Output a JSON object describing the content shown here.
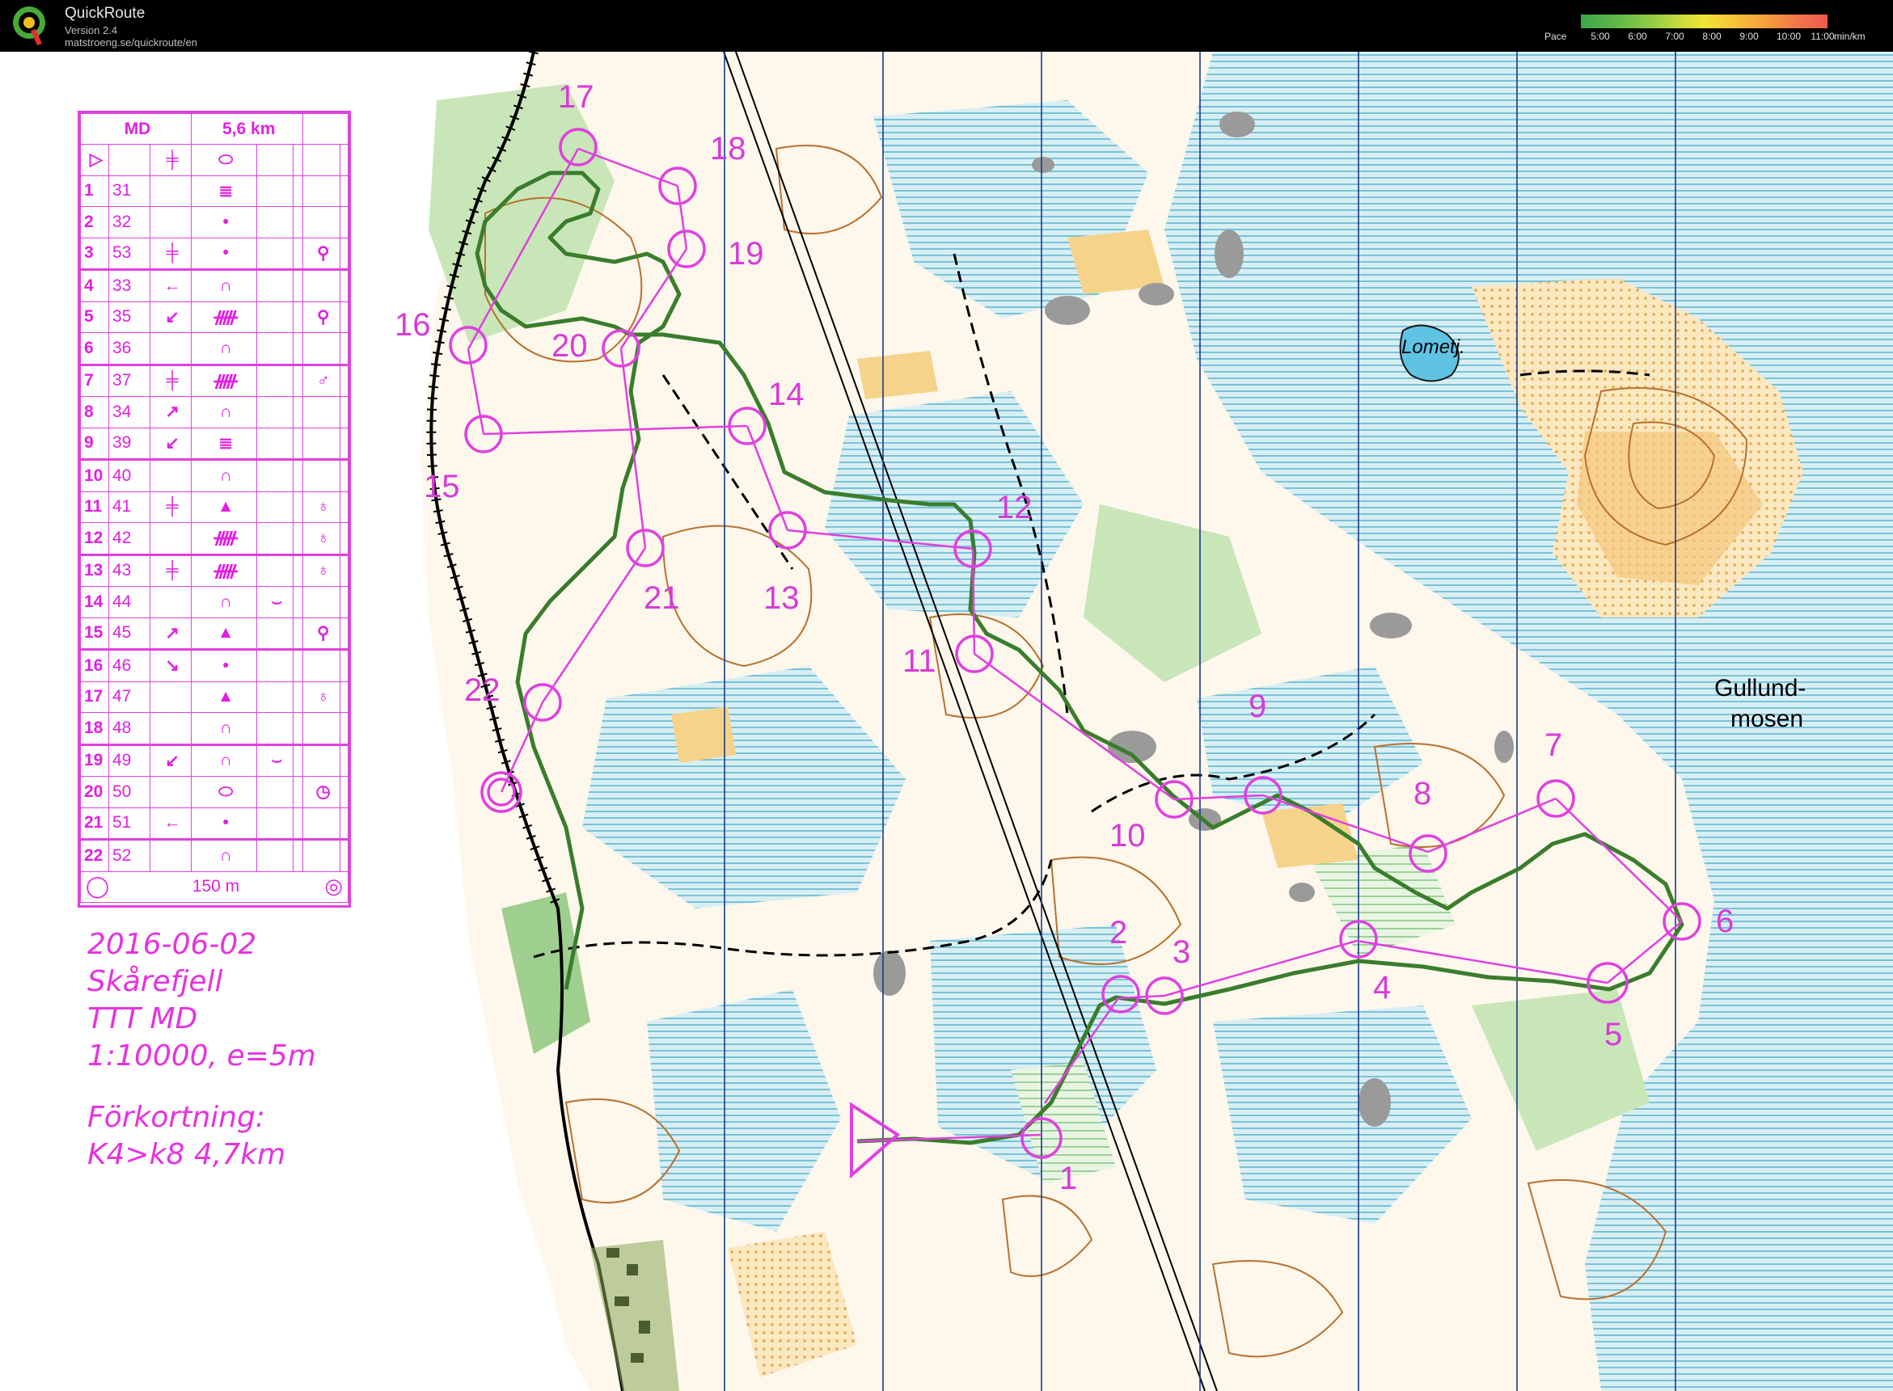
{
  "app": {
    "title": "QuickRoute",
    "version": "Version 2.4",
    "url": "matstroeng.se/quickroute/en",
    "pace_label": "Pace",
    "pace_ticks": [
      "5:00",
      "6:00",
      "7:00",
      "8:00",
      "9:00",
      "10:00",
      "11:00"
    ],
    "pace_unit": "min/km"
  },
  "legend": {
    "event": "MD",
    "length": "5,6 km",
    "rows": [
      {
        "n": "1",
        "code": "31",
        "col3": "",
        "col4": "≣",
        "col5": "",
        "col6": ""
      },
      {
        "n": "2",
        "code": "32",
        "col3": "",
        "col4": "•",
        "col5": "",
        "col6": ""
      },
      {
        "n": "3",
        "code": "53",
        "col3": "╪",
        "col4": "•",
        "col5": "",
        "col6": "⚲"
      },
      {
        "n": "4",
        "code": "33",
        "col3": "←",
        "col4": "∩",
        "col5": "",
        "col6": ""
      },
      {
        "n": "5",
        "code": "35",
        "col3": "↙",
        "col4": "ᚏ",
        "col5": "",
        "col6": "⚲"
      },
      {
        "n": "6",
        "code": "36",
        "col3": "",
        "col4": "∩",
        "col5": "",
        "col6": ""
      },
      {
        "n": "7",
        "code": "37",
        "col3": "╪",
        "col4": "ᚏ",
        "col5": "",
        "col6": "♂"
      },
      {
        "n": "8",
        "code": "34",
        "col3": "↗",
        "col4": "∩",
        "col5": "",
        "col6": ""
      },
      {
        "n": "9",
        "code": "39",
        "col3": "↙",
        "col4": "≣",
        "col5": "",
        "col6": ""
      },
      {
        "n": "10",
        "code": "40",
        "col3": "",
        "col4": "∩",
        "col5": "",
        "col6": ""
      },
      {
        "n": "11",
        "code": "41",
        "col3": "╪",
        "col4": "▲",
        "col5": "",
        "col6": "♁"
      },
      {
        "n": "12",
        "code": "42",
        "col3": "",
        "col4": "ᚏ",
        "col5": "",
        "col6": "♁"
      },
      {
        "n": "13",
        "code": "43",
        "col3": "╪",
        "col4": "ᚏ",
        "col5": "",
        "col6": "♁"
      },
      {
        "n": "14",
        "code": "44",
        "col3": "",
        "col4": "∩",
        "col5": "⌣",
        "col6": ""
      },
      {
        "n": "15",
        "code": "45",
        "col3": "↗",
        "col4": "▲",
        "col5": "",
        "col6": "⚲"
      },
      {
        "n": "16",
        "code": "46",
        "col3": "↘",
        "col4": "•",
        "col5": "",
        "col6": ""
      },
      {
        "n": "17",
        "code": "47",
        "col3": "",
        "col4": "▲",
        "col5": "",
        "col6": "♁"
      },
      {
        "n": "18",
        "code": "48",
        "col3": "",
        "col4": "∩",
        "col5": "",
        "col6": ""
      },
      {
        "n": "19",
        "code": "49",
        "col3": "↙",
        "col4": "∩",
        "col5": "⌣",
        "col6": ""
      },
      {
        "n": "20",
        "code": "50",
        "col3": "",
        "col4": "⬭",
        "col5": "",
        "col6": "◷"
      },
      {
        "n": "21",
        "code": "51",
        "col3": "←",
        "col4": "•",
        "col5": "",
        "col6": ""
      },
      {
        "n": "22",
        "code": "52",
        "col3": "",
        "col4": "∩",
        "col5": "",
        "col6": ""
      }
    ],
    "finish": "150 m"
  },
  "notes": {
    "date": "2016-06-02",
    "place": "Skårefjell",
    "event": "TTT MD",
    "scale": "1:10000, e=5m",
    "shortening_title": "Förkortning:",
    "shortening": "K4>k8 4,7km"
  },
  "map_labels": {
    "lake": "Lometj.",
    "bog_1": "Gullund-",
    "bog_2": "mosen"
  },
  "controls": [
    {
      "n": "1"
    },
    {
      "n": "2"
    },
    {
      "n": "3"
    },
    {
      "n": "4"
    },
    {
      "n": "5"
    },
    {
      "n": "6"
    },
    {
      "n": "7"
    },
    {
      "n": "8"
    },
    {
      "n": "9"
    },
    {
      "n": "10"
    },
    {
      "n": "11"
    },
    {
      "n": "12"
    },
    {
      "n": "13"
    },
    {
      "n": "14"
    },
    {
      "n": "15"
    },
    {
      "n": "16"
    },
    {
      "n": "17"
    },
    {
      "n": "18"
    },
    {
      "n": "19"
    },
    {
      "n": "20"
    },
    {
      "n": "21"
    },
    {
      "n": "22"
    }
  ],
  "colors": {
    "course": "#e040e0",
    "route": "#3a7d2c",
    "open_land": "#f6d38a",
    "marsh": "#a9dde9",
    "green": "#9fcf8e",
    "rock": "#9a9a9a",
    "contour": "#b8712e"
  }
}
